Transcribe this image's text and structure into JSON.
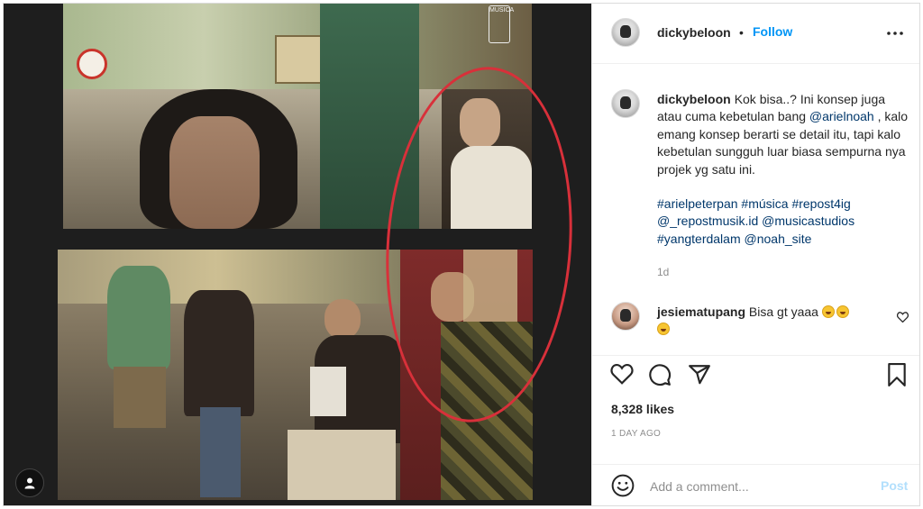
{
  "post": {
    "author": "dickybeloon",
    "follow_label": "Follow",
    "separator": "•",
    "media": {
      "watermark_text": "MUSICA"
    }
  },
  "caption": {
    "username": "dickybeloon",
    "text_before": "Kok bisa..? Ini konsep juga atau cuma kebetulan bang ",
    "mention1": "@arielnoah",
    "text_after": " , kalo emang konsep berarti se detail itu, tapi kalo kebetulan sungguh luar biasa sempurna nya projek yg satu ini.",
    "tag1": "#arielpeterpan",
    "tag2": "#música",
    "tag3": "#repost4ig",
    "tag4": "@_repostmusik.id",
    "tag5": "@musicastudios",
    "tag6": "#yangterdalam",
    "tag7": "@noah_site",
    "time": "1d"
  },
  "comment": {
    "username": "jesiematupang",
    "text": "Bisa gt yaaa"
  },
  "actions": {
    "likes": "8,328 likes",
    "date": "1 DAY AGO"
  },
  "add_comment": {
    "placeholder": "Add a comment...",
    "post_label": "Post"
  },
  "icons": {
    "more": "more-horizontal-icon",
    "like": "heart-icon",
    "comment": "comment-icon",
    "share": "share-icon",
    "save": "bookmark-icon",
    "emoji": "smile-icon",
    "user": "user-icon"
  }
}
